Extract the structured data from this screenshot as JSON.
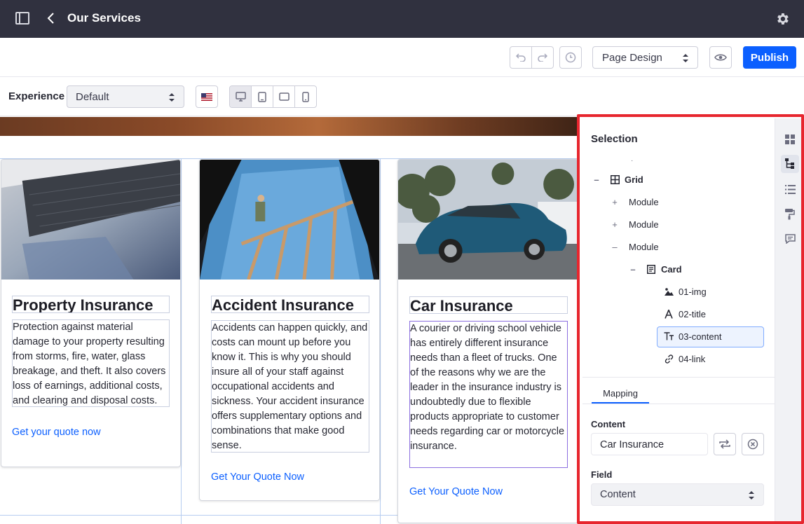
{
  "header": {
    "title": "Our Services"
  },
  "toolbar": {
    "design_select": "Page Design",
    "publish_label": "Publish"
  },
  "experience": {
    "label": "Experience",
    "value": "Default"
  },
  "cards": [
    {
      "title": "Property Insurance",
      "content": "Protection against material damage to your property resulting from storms, fire, water, glass breakage, and theft. It also covers loss of earnings, additional costs, and clearing and disposal costs.",
      "link": "Get your quote now"
    },
    {
      "title": "Accident Insurance",
      "content": "Accidents can happen quickly, and costs can mount up before you know it. This is why you should insure all of your staff against occupational accidents and sickness. Your accident insurance offers supplementary options and combinations that make good sense.",
      "link": "Get Your Quote Now"
    },
    {
      "title": "Car Insurance",
      "content": "A courier or driving school vehicle has entirely different insurance needs than a fleet of trucks. One of the reasons why we are the leader in the insurance industry is undoubtedly due to flexible products appropriate to customer needs regarding car or motorcycle insurance.",
      "link": "Get Your Quote Now"
    }
  ],
  "panel": {
    "title": "Selection",
    "tree": {
      "grid": "Grid",
      "module1": "Module",
      "module2": "Module",
      "module3": "Module",
      "card": "Card",
      "img": "01-img",
      "title": "02-title",
      "content": "03-content",
      "link": "04-link"
    },
    "tab": "Mapping",
    "content_label": "Content",
    "content_value": "Car Insurance",
    "field_label": "Field",
    "field_value": "Content"
  },
  "colors": {
    "topbar": "#30313f",
    "primary": "#0b5fff",
    "highlight": "#e7262e"
  }
}
